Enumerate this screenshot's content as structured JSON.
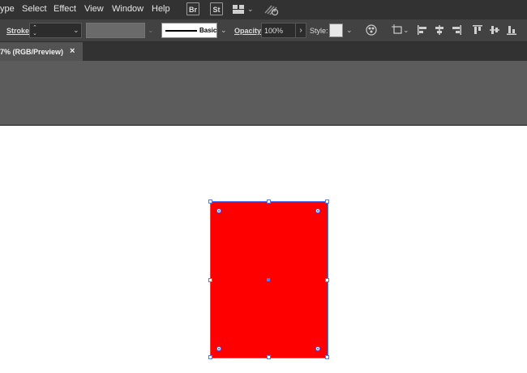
{
  "menubar": {
    "items": [
      "ype",
      "Select",
      "Effect",
      "View",
      "Window",
      "Help"
    ],
    "bridge_label": "Br",
    "stock_label": "St"
  },
  "control_bar": {
    "stroke_label": "Stroke:",
    "stroke_value": "",
    "brush_label": "Basic",
    "opacity_label": "Opacity:",
    "opacity_value": "100%",
    "style_label": "Style:"
  },
  "document_tab": {
    "title": "7% (RGB/Preview)",
    "close_glyph": "×"
  },
  "canvas": {
    "shape_fill": "#ff0000",
    "selection_color": "#4d79ff"
  },
  "colors": {
    "menubar_bg": "#323232",
    "controlbar_bg": "#424242",
    "panel_bg": "#5c5c5c"
  }
}
